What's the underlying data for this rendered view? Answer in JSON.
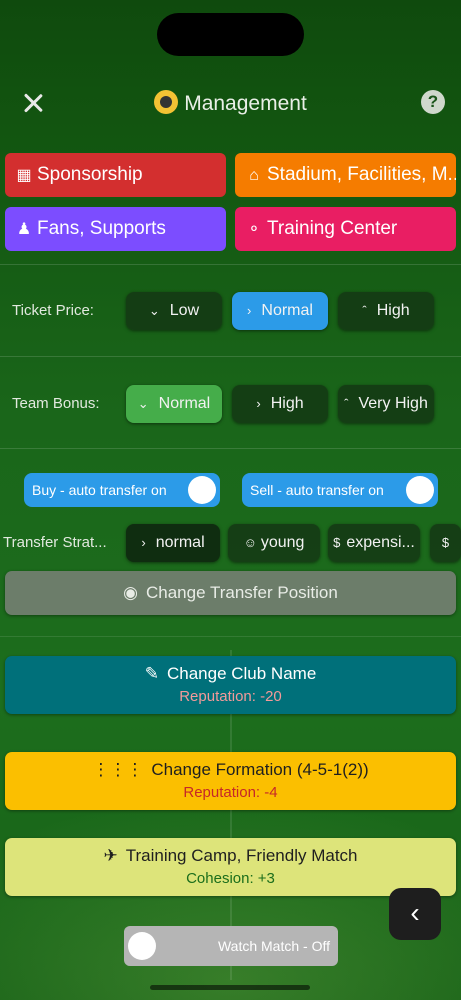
{
  "header": {
    "title": "Management"
  },
  "categories": [
    {
      "label": "Sponsorship",
      "icon": "shop-icon",
      "color": "#d32f2f"
    },
    {
      "label": "Stadium, Facilities, M...",
      "icon": "home-icon",
      "color": "#f57c00"
    },
    {
      "label": "Fans, Supports",
      "icon": "person-icon",
      "color": "#7c4dff"
    },
    {
      "label": "Training Center",
      "icon": "lightbulb-icon",
      "color": "#e91e63"
    }
  ],
  "ticket": {
    "label": "Ticket Price:",
    "options": [
      "Low",
      "Normal",
      "High"
    ],
    "selected": "Normal"
  },
  "bonus": {
    "label": "Team Bonus:",
    "options": [
      "Normal",
      "High",
      "Very High"
    ],
    "selected": "Normal"
  },
  "toggles": {
    "buy": "Buy - auto transfer on",
    "sell": "Sell - auto transfer on"
  },
  "strategy": {
    "label": "Transfer Strat...",
    "options": [
      "normal",
      "young",
      "expensi..."
    ],
    "selected": "normal"
  },
  "actions": {
    "position": "Change Transfer Position",
    "club_name": {
      "label": "Change Club Name",
      "sub": "Reputation: -20"
    },
    "formation": {
      "label": "Change Formation (4-5-1(2))",
      "sub": "Reputation: -4"
    },
    "camp": {
      "label": "Training Camp, Friendly Match",
      "sub": "Cohesion: +3"
    }
  },
  "watch": {
    "label": "Watch Match - Off"
  }
}
